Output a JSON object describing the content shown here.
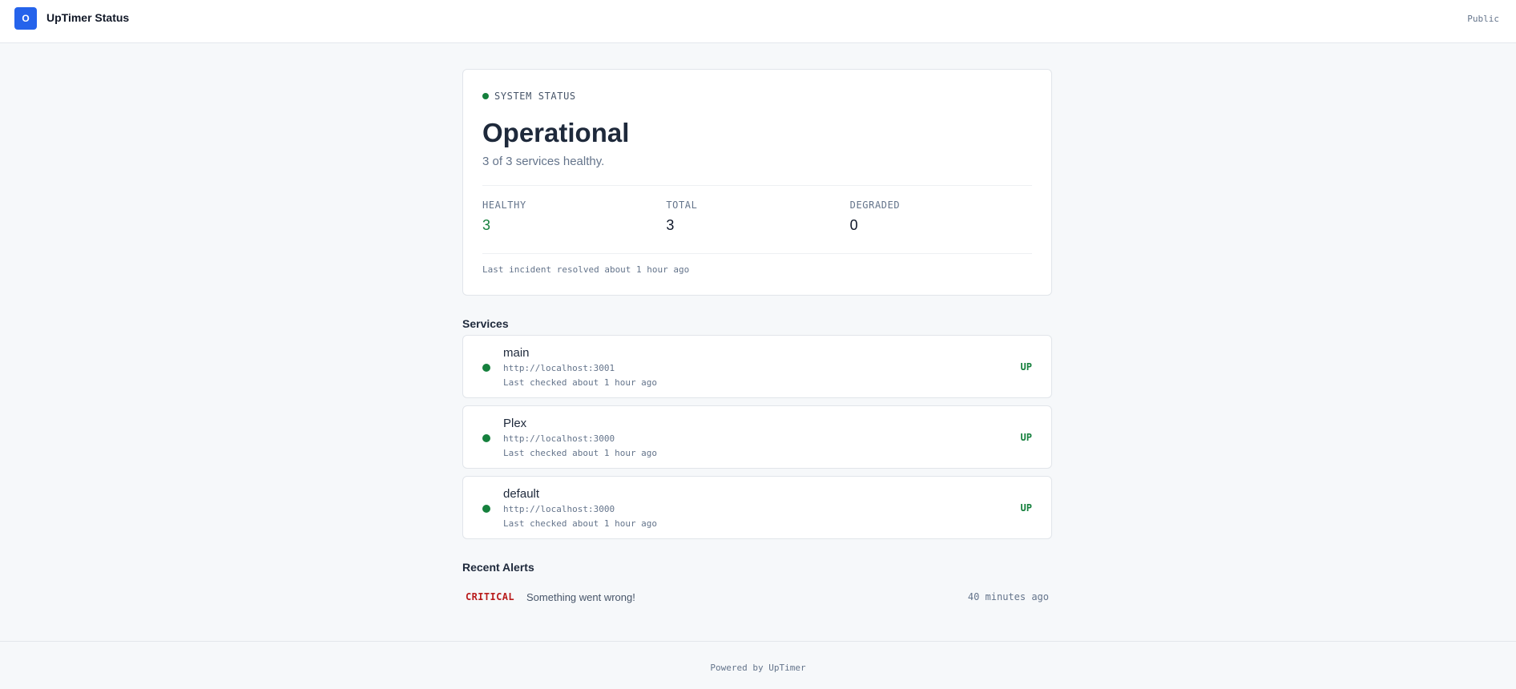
{
  "header": {
    "logo_letter": "O",
    "title": "UpTimer Status",
    "visibility": "Public"
  },
  "status": {
    "label": "SYSTEM STATUS",
    "headline": "Operational",
    "summary": "3 of 3 services healthy.",
    "stats": [
      {
        "label": "HEALTHY",
        "value": "3"
      },
      {
        "label": "TOTAL",
        "value": "3"
      },
      {
        "label": "DEGRADED",
        "value": "0"
      }
    ],
    "incident": "Last incident resolved about 1 hour ago"
  },
  "services": {
    "title": "Services",
    "items": [
      {
        "name": "main",
        "url": "http://localhost:3001",
        "checked": "Last checked about 1 hour ago",
        "state": "UP"
      },
      {
        "name": "Plex",
        "url": "http://localhost:3000",
        "checked": "Last checked about 1 hour ago",
        "state": "UP"
      },
      {
        "name": "default",
        "url": "http://localhost:3000",
        "checked": "Last checked about 1 hour ago",
        "state": "UP"
      }
    ]
  },
  "alerts": {
    "title": "Recent Alerts",
    "items": [
      {
        "severity": "CRITICAL",
        "message": "Something went wrong!",
        "time": "40 minutes ago"
      }
    ]
  },
  "footer": {
    "text": "Powered by UpTimer"
  },
  "colors": {
    "accent": "#2563eb",
    "healthy": "#15803d",
    "critical": "#b91c1c"
  }
}
